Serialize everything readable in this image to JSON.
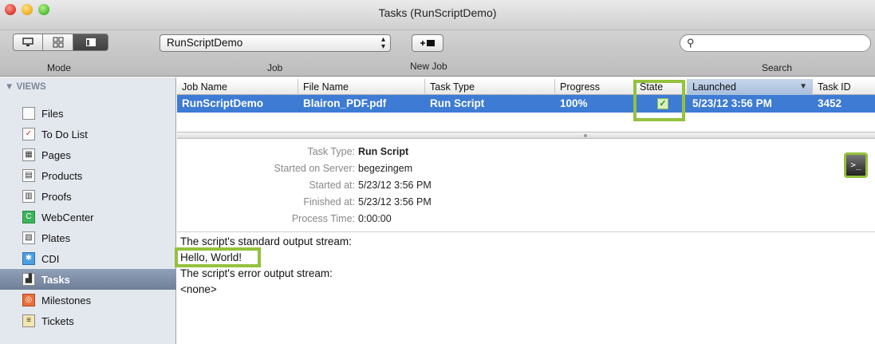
{
  "window": {
    "title": "Tasks (RunScriptDemo)"
  },
  "toolbar": {
    "mode_label": "Mode",
    "job_label": "Job",
    "job_value": "RunScriptDemo",
    "new_job_label": "New Job",
    "search_label": "Search",
    "search_placeholder": ""
  },
  "sidebar": {
    "header": "VIEWS",
    "items": [
      {
        "label": "Files",
        "icon": "document-icon"
      },
      {
        "label": "To Do List",
        "icon": "checklist-icon"
      },
      {
        "label": "Pages",
        "icon": "pages-icon"
      },
      {
        "label": "Products",
        "icon": "products-icon"
      },
      {
        "label": "Proofs",
        "icon": "proofs-icon"
      },
      {
        "label": "WebCenter",
        "icon": "webcenter-icon"
      },
      {
        "label": "Plates",
        "icon": "plates-icon"
      },
      {
        "label": "CDI",
        "icon": "cdi-icon"
      },
      {
        "label": "Tasks",
        "icon": "tasks-icon",
        "selected": true
      },
      {
        "label": "Milestones",
        "icon": "milestones-icon"
      },
      {
        "label": "Tickets",
        "icon": "tickets-icon"
      }
    ]
  },
  "table": {
    "columns": [
      "Job Name",
      "File Name",
      "Task Type",
      "Progress",
      "State",
      "Launched",
      "Task ID"
    ],
    "sorted_column": "Launched",
    "rows": [
      {
        "job_name": "RunScriptDemo",
        "file_name": "Blairon_PDF.pdf",
        "task_type": "Run Script",
        "progress": "100%",
        "state": "checked",
        "launched": "5/23/12 3:56 PM",
        "task_id": "3452"
      }
    ]
  },
  "details": {
    "task_type_label": "Task Type:",
    "task_type_value": "Run Script",
    "server_label": "Started on Server:",
    "server_value": "begezingem",
    "started_label": "Started at:",
    "started_value": "5/23/12 3:56 PM",
    "finished_label": "Finished at:",
    "finished_value": "5/23/12 3:56 PM",
    "process_label": "Process Time:",
    "process_value": "0:00:00"
  },
  "output": {
    "stdout_header": "The script's standard output stream:",
    "stdout_value": "Hello, World!",
    "stderr_header": "The script's error output stream:",
    "stderr_value": "<none>"
  },
  "colors": {
    "selection": "#3d7bd4",
    "highlight": "#93c23c",
    "sidebar_bg": "#e3e8ee"
  }
}
